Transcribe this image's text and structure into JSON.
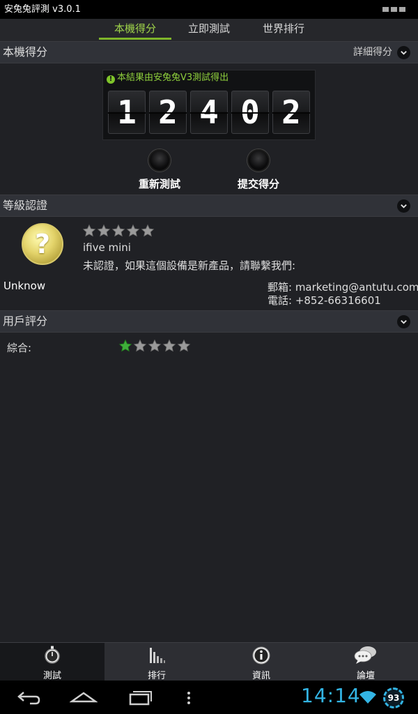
{
  "app": {
    "title": "安兔兔評測 v3.0.1"
  },
  "tabs": [
    {
      "label": "本機得分",
      "active": true
    },
    {
      "label": "立即測試",
      "active": false
    },
    {
      "label": "世界排行",
      "active": false
    }
  ],
  "score_section": {
    "title": "本機得分",
    "detail_label": "詳細得分",
    "note": "本結果由安兔兔V3測試得出",
    "digits": [
      "1",
      "2",
      "4",
      "0",
      "2"
    ],
    "retest_label": "重新測試",
    "submit_label": "提交得分"
  },
  "cert_section": {
    "title": "等級認證",
    "badge_symbol": "?",
    "rating_stars": 0,
    "device_name": "ifive mini",
    "message": "未認證，如果這個設備是新產品，請聯繫我們:",
    "status": "Unknow",
    "email_line": "郵箱: marketing@antutu.com",
    "phone_line": "電話: +852-66316601"
  },
  "user_section": {
    "title": "用戶評分",
    "overall_label": "綜合:",
    "overall_stars": 1
  },
  "bottom_nav": [
    {
      "label": "測試",
      "icon": "stopwatch-icon",
      "active": true
    },
    {
      "label": "排行",
      "icon": "bar-chart-icon",
      "active": false
    },
    {
      "label": "資訊",
      "icon": "info-icon",
      "active": false
    },
    {
      "label": "論壇",
      "icon": "chat-bubbles-icon",
      "active": false
    }
  ],
  "system_bar": {
    "time": "14:14",
    "battery": "93",
    "accent_color": "#33b5e5"
  }
}
